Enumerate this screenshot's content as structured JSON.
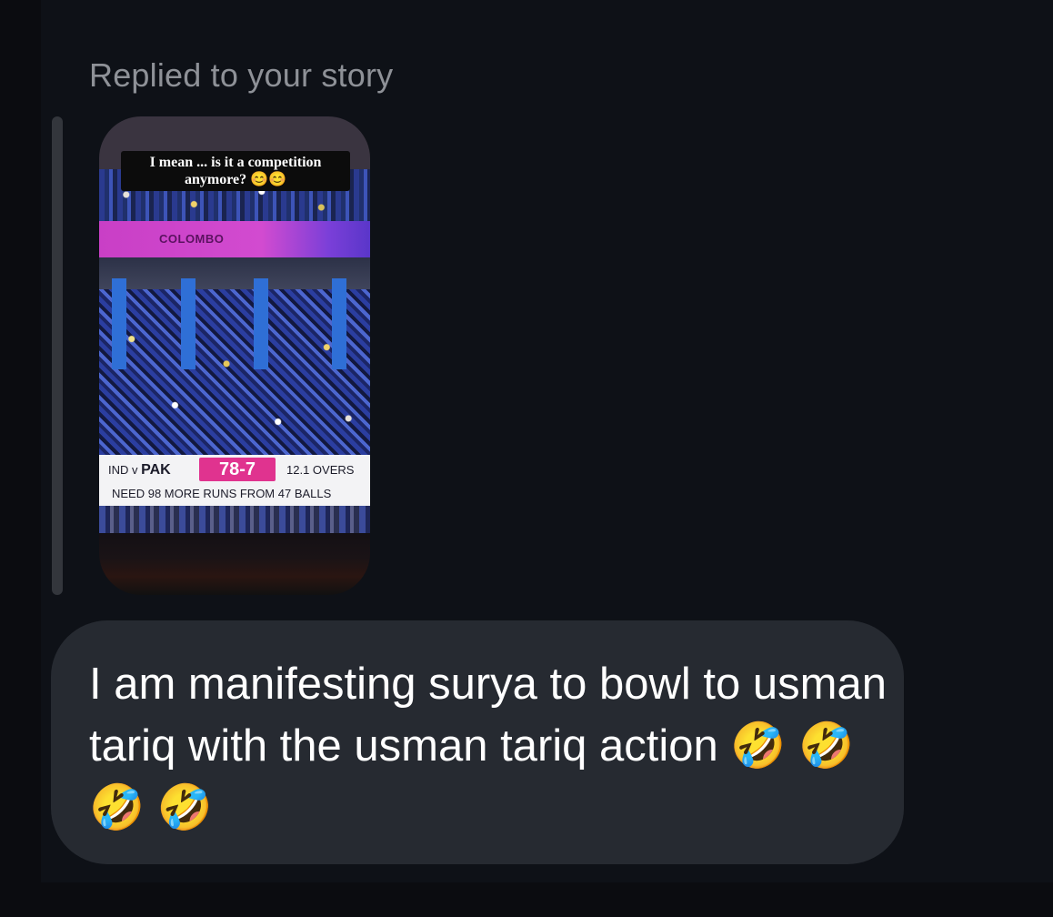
{
  "thread": {
    "reply_label": "Replied to your story"
  },
  "story": {
    "caption": "I mean ... is it a competition anymore? 😊😊",
    "banner": "COLOMBO",
    "scoreboard": {
      "teams_prefix": "IND v ",
      "team_bold": "PAK",
      "score": "78-7",
      "overs": "12.1 OVERS",
      "need_text": "NEED 98 MORE RUNS FROM 47 BALLS"
    }
  },
  "message": {
    "text": "I am manifesting surya to bowl to usman tariq with the usman tariq action 🤣 🤣 🤣 🤣"
  },
  "colors": {
    "background": "#0e1117",
    "bubble": "#262a31",
    "muted_text": "#8e9197",
    "score_accent": "#e0338f"
  }
}
